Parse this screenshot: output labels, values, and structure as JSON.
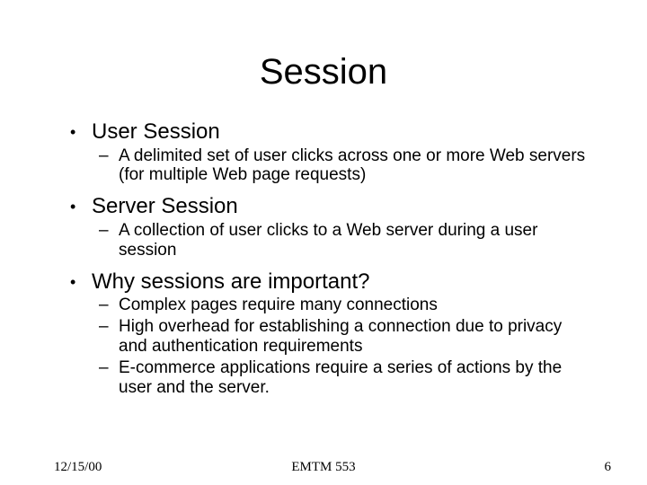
{
  "title": "Session",
  "bullets": [
    {
      "text": "User Session",
      "sub": [
        "A delimited set of user clicks across one or more Web servers (for multiple Web page requests)"
      ]
    },
    {
      "text": "Server Session",
      "sub": [
        "A collection of user clicks to a Web server during a user session"
      ]
    },
    {
      "text": "Why sessions are important?",
      "sub": [
        "Complex pages require many connections",
        "High overhead for establishing a connection due to privacy and authentication requirements",
        "E-commerce applications require a series of actions by the user and the server."
      ]
    }
  ],
  "footer": {
    "date": "12/15/00",
    "course": "EMTM 553",
    "page": "6"
  }
}
